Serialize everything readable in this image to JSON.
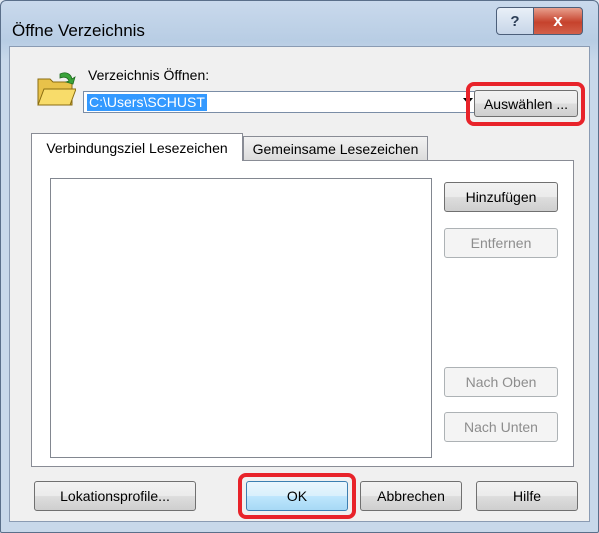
{
  "window": {
    "title": "Öffne Verzeichnis",
    "help_glyph": "?",
    "close_glyph": "x"
  },
  "directory": {
    "label": "Verzeichnis Öffnen:",
    "value": "C:\\Users\\SCHUST",
    "browse_button": "Auswählen ..."
  },
  "tabs": [
    {
      "label": "Verbindungsziel Lesezeichen",
      "active": true
    },
    {
      "label": "Gemeinsame Lesezeichen",
      "active": false
    }
  ],
  "bookmark_buttons": {
    "add": "Hinzufügen",
    "remove": "Entfernen",
    "move_up": "Nach Oben",
    "move_down": "Nach Unten"
  },
  "footer": {
    "profiles": "Lokationsprofile...",
    "ok": "OK",
    "cancel": "Abbrechen",
    "help": "Hilfe"
  },
  "colors": {
    "highlight": "#e8232a",
    "selection": "#3399ff",
    "close_button": "#c6422c"
  },
  "icons": {
    "folder": "folder-open-icon",
    "dropdown": "chevron-down-icon"
  }
}
